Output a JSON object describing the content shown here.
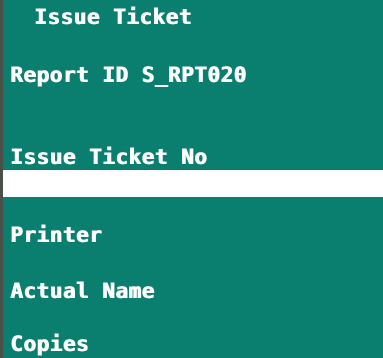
{
  "screen": {
    "title": "Issue Ticket",
    "report_id_label": "Report ID S_RPT020",
    "issue_ticket_label": "Issue Ticket No",
    "issue_ticket_value": "",
    "printer_label": "Printer",
    "actual_name_label": "Actual Name",
    "copies_label": "Copies"
  },
  "colors": {
    "background": "#0b7f6f",
    "text": "#ffffff",
    "input_background": "#ffffff",
    "left_border": "#4a4f4a"
  }
}
